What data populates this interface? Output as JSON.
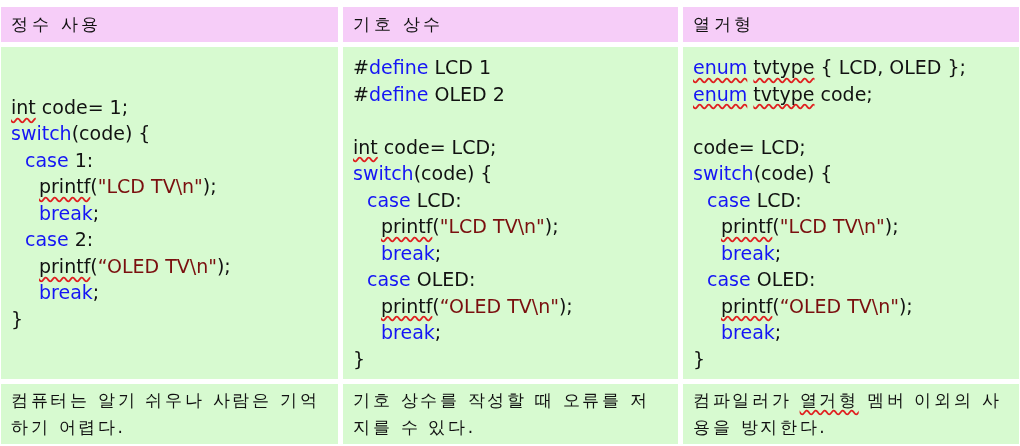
{
  "table": {
    "columns": [
      {
        "header": "정수 사용",
        "code": [
          {
            "tokens": [
              {
                "text": "int",
                "kind": "misspelled"
              },
              {
                "text": " code= 1;",
                "kind": "plain"
              }
            ]
          },
          {
            "tokens": [
              {
                "text": "switch",
                "kind": "keyword"
              },
              {
                "text": "(code) {",
                "kind": "plain"
              }
            ],
            "children": [
              {
                "tokens": [
                  {
                    "text": "case",
                    "kind": "keyword"
                  },
                  {
                    "text": " 1:",
                    "kind": "plain"
                  }
                ],
                "children": [
                  {
                    "tokens": [
                      {
                        "text": "printf",
                        "kind": "misspelled"
                      },
                      {
                        "text": "(",
                        "kind": "plain"
                      },
                      {
                        "text": "\"LCD TV\\n\"",
                        "kind": "string"
                      },
                      {
                        "text": ");",
                        "kind": "plain"
                      }
                    ]
                  },
                  {
                    "tokens": [
                      {
                        "text": "break",
                        "kind": "keyword"
                      },
                      {
                        "text": ";",
                        "kind": "plain"
                      }
                    ]
                  }
                ]
              },
              {
                "tokens": [
                  {
                    "text": "case",
                    "kind": "keyword"
                  },
                  {
                    "text": " 2:",
                    "kind": "plain"
                  }
                ],
                "children": [
                  {
                    "tokens": [
                      {
                        "text": "printf",
                        "kind": "misspelled"
                      },
                      {
                        "text": "(",
                        "kind": "plain"
                      },
                      {
                        "text": "“OLED TV\\n\"",
                        "kind": "string"
                      },
                      {
                        "text": ");",
                        "kind": "plain"
                      }
                    ]
                  },
                  {
                    "tokens": [
                      {
                        "text": "break",
                        "kind": "keyword"
                      },
                      {
                        "text": ";",
                        "kind": "plain"
                      }
                    ]
                  }
                ]
              }
            ]
          },
          {
            "tokens": [
              {
                "text": "}",
                "kind": "plain"
              }
            ]
          }
        ],
        "note": [
          {
            "text": "컴퓨터는 알기 쉬우나 사람은 기억하기 어렵다.",
            "kind": "plain"
          }
        ]
      },
      {
        "header": "기호 상수",
        "code": [
          {
            "tokens": [
              {
                "text": "#",
                "kind": "plain"
              },
              {
                "text": "define",
                "kind": "keyword"
              },
              {
                "text": " LCD 1",
                "kind": "plain"
              }
            ]
          },
          {
            "tokens": [
              {
                "text": "#",
                "kind": "plain"
              },
              {
                "text": "define",
                "kind": "keyword"
              },
              {
                "text": " OLED 2",
                "kind": "plain"
              }
            ]
          },
          {
            "kind": "blank"
          },
          {
            "tokens": [
              {
                "text": "int",
                "kind": "misspelled"
              },
              {
                "text": " code= LCD;",
                "kind": "plain"
              }
            ]
          },
          {
            "tokens": [
              {
                "text": "switch",
                "kind": "keyword"
              },
              {
                "text": "(code) {",
                "kind": "plain"
              }
            ],
            "children": [
              {
                "tokens": [
                  {
                    "text": "case",
                    "kind": "keyword"
                  },
                  {
                    "text": " LCD:",
                    "kind": "plain"
                  }
                ],
                "children": [
                  {
                    "tokens": [
                      {
                        "text": "printf",
                        "kind": "misspelled"
                      },
                      {
                        "text": "(",
                        "kind": "plain"
                      },
                      {
                        "text": "\"LCD TV\\n\"",
                        "kind": "string"
                      },
                      {
                        "text": ");",
                        "kind": "plain"
                      }
                    ]
                  },
                  {
                    "tokens": [
                      {
                        "text": "break",
                        "kind": "keyword"
                      },
                      {
                        "text": ";",
                        "kind": "plain"
                      }
                    ]
                  }
                ]
              },
              {
                "tokens": [
                  {
                    "text": "case",
                    "kind": "keyword"
                  },
                  {
                    "text": " OLED:",
                    "kind": "plain"
                  }
                ],
                "children": [
                  {
                    "tokens": [
                      {
                        "text": "printf",
                        "kind": "misspelled"
                      },
                      {
                        "text": "(",
                        "kind": "plain"
                      },
                      {
                        "text": "“OLED TV\\n\"",
                        "kind": "string"
                      },
                      {
                        "text": ");",
                        "kind": "plain"
                      }
                    ]
                  },
                  {
                    "tokens": [
                      {
                        "text": "break",
                        "kind": "keyword"
                      },
                      {
                        "text": ";",
                        "kind": "plain"
                      }
                    ]
                  }
                ]
              }
            ]
          },
          {
            "tokens": [
              {
                "text": "}",
                "kind": "plain"
              }
            ]
          }
        ],
        "note": [
          {
            "text": "기호 상수를 작성할 때 오류를 저지를 수 있다.",
            "kind": "plain"
          }
        ]
      },
      {
        "header": "열거형",
        "code": [
          {
            "tokens": [
              {
                "text": "enum",
                "kind": "misspelled_keyword"
              },
              {
                "text": " tvtype",
                "kind": "misspelled"
              },
              {
                "text": " { LCD, OLED };",
                "kind": "plain"
              }
            ]
          },
          {
            "tokens": [
              {
                "text": "enum",
                "kind": "misspelled_keyword"
              },
              {
                "text": " tvtype",
                "kind": "misspelled"
              },
              {
                "text": " code;",
                "kind": "plain"
              }
            ]
          },
          {
            "kind": "blank"
          },
          {
            "tokens": [
              {
                "text": "code= LCD;",
                "kind": "plain"
              }
            ]
          },
          {
            "tokens": [
              {
                "text": "switch",
                "kind": "keyword"
              },
              {
                "text": "(code) {",
                "kind": "plain"
              }
            ],
            "children": [
              {
                "tokens": [
                  {
                    "text": "case",
                    "kind": "keyword"
                  },
                  {
                    "text": " LCD:",
                    "kind": "plain"
                  }
                ],
                "children": [
                  {
                    "tokens": [
                      {
                        "text": "printf",
                        "kind": "misspelled"
                      },
                      {
                        "text": "(",
                        "kind": "plain"
                      },
                      {
                        "text": "\"LCD TV\\n\"",
                        "kind": "string"
                      },
                      {
                        "text": ");",
                        "kind": "plain"
                      }
                    ]
                  },
                  {
                    "tokens": [
                      {
                        "text": "break",
                        "kind": "keyword"
                      },
                      {
                        "text": ";",
                        "kind": "plain"
                      }
                    ]
                  }
                ]
              },
              {
                "tokens": [
                  {
                    "text": "case",
                    "kind": "keyword"
                  },
                  {
                    "text": " OLED:",
                    "kind": "plain"
                  }
                ],
                "children": [
                  {
                    "tokens": [
                      {
                        "text": "printf",
                        "kind": "misspelled"
                      },
                      {
                        "text": "(",
                        "kind": "plain"
                      },
                      {
                        "text": "“OLED TV\\n\"",
                        "kind": "string"
                      },
                      {
                        "text": ");",
                        "kind": "plain"
                      }
                    ]
                  },
                  {
                    "tokens": [
                      {
                        "text": "break",
                        "kind": "keyword"
                      },
                      {
                        "text": ";",
                        "kind": "plain"
                      }
                    ]
                  }
                ]
              }
            ]
          },
          {
            "tokens": [
              {
                "text": "}",
                "kind": "plain"
              }
            ]
          }
        ],
        "note": [
          {
            "text": "컴파일러가 ",
            "kind": "plain"
          },
          {
            "text": "열거형",
            "kind": "misspelled"
          },
          {
            "text": " 멤버 이외의 사용을 방지한다.",
            "kind": "plain"
          }
        ]
      }
    ]
  }
}
